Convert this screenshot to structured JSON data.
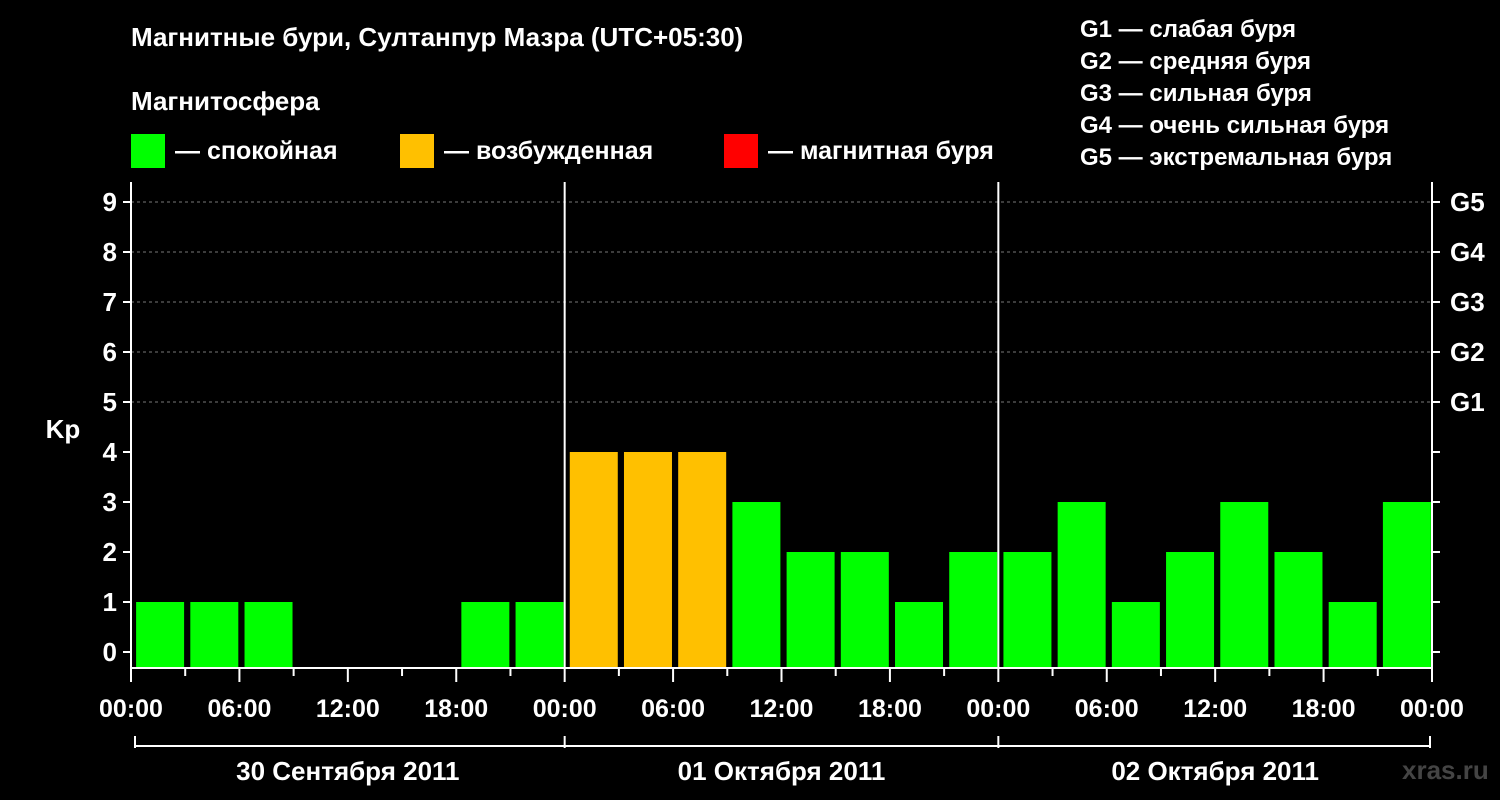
{
  "chart_data": {
    "type": "bar",
    "title": "Магнитные бури, Султанпур Мазра (UTC+05:30)",
    "subtitle": "Магнитосфера",
    "ylabel": "Kp",
    "ylim": [
      0,
      9
    ],
    "yticks": [
      "0",
      "1",
      "2",
      "3",
      "4",
      "5",
      "6",
      "7",
      "8",
      "9"
    ],
    "storm_levels": [
      {
        "kp": 5,
        "label": "G1"
      },
      {
        "kp": 6,
        "label": "G2"
      },
      {
        "kp": 7,
        "label": "G3"
      },
      {
        "kp": 8,
        "label": "G4"
      },
      {
        "kp": 9,
        "label": "G5"
      }
    ],
    "xtick_labels": [
      "00:00",
      "06:00",
      "12:00",
      "18:00",
      "00:00",
      "06:00",
      "12:00",
      "18:00",
      "00:00",
      "06:00",
      "12:00",
      "18:00",
      "00:00"
    ],
    "days": [
      "30 Сентября 2011",
      "01 Октября 2011",
      "02 Октября 2011"
    ],
    "values": [
      1,
      1,
      1,
      null,
      null,
      null,
      1,
      1,
      4,
      4,
      4,
      3,
      2,
      2,
      1,
      2,
      2,
      3,
      1,
      2,
      3,
      2,
      1,
      3
    ],
    "legend": [
      {
        "label": "— спокойная",
        "color": "#00ff00"
      },
      {
        "label": "— возбужденная",
        "color": "#ffc000"
      },
      {
        "label": "— магнитная буря",
        "color": "#ff0000"
      }
    ],
    "colors": {
      "quiet": "#00ff00",
      "unsettled": "#ffc000",
      "storm": "#ff0000"
    },
    "grid": true
  },
  "g_legend": [
    "G1 — слабая буря",
    "G2 — средняя буря",
    "G3 — сильная буря",
    "G4 — очень сильная буря",
    "G5 — экстремальная буря"
  ],
  "watermark": "xras.ru"
}
